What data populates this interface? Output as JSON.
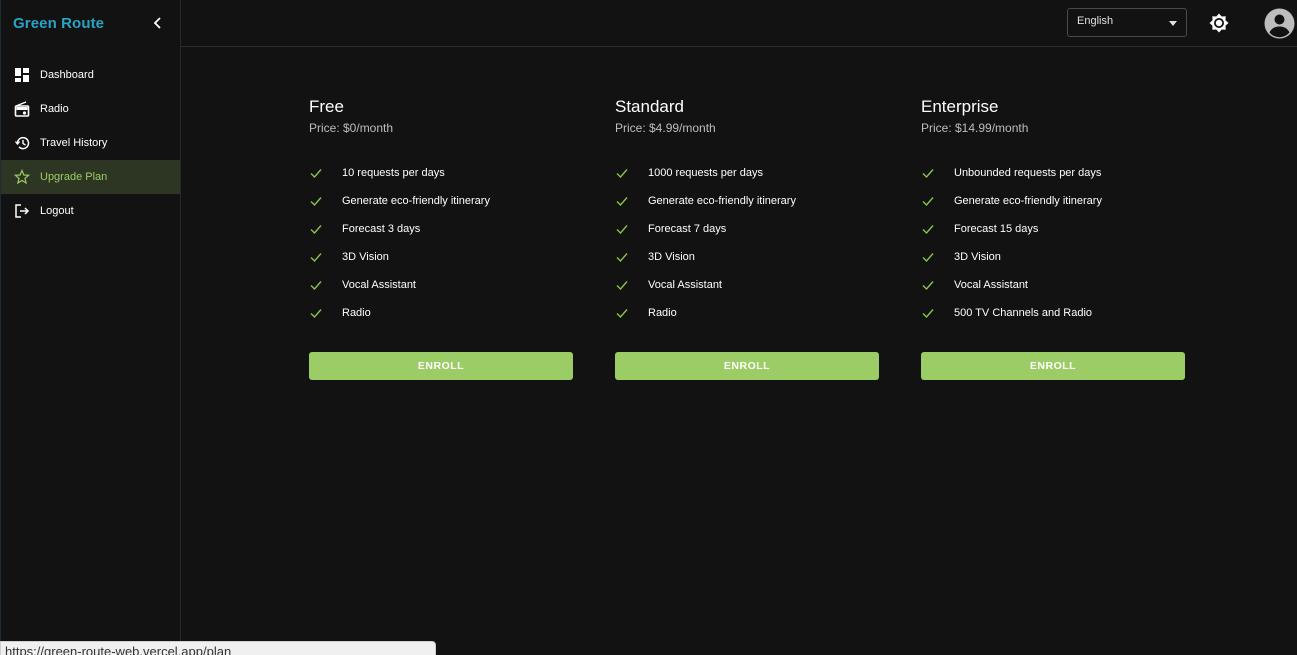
{
  "sidebar": {
    "brand": "Green Route",
    "items": [
      {
        "label": "Dashboard",
        "icon": "dashboard-icon"
      },
      {
        "label": "Radio",
        "icon": "radio-icon"
      },
      {
        "label": "Travel History",
        "icon": "history-icon"
      },
      {
        "label": "Upgrade Plan",
        "icon": "star-icon",
        "active": true
      },
      {
        "label": "Logout",
        "icon": "logout-icon"
      }
    ]
  },
  "topbar": {
    "language": "English"
  },
  "plans": [
    {
      "name": "Free",
      "price": "Price: $0/month",
      "features": [
        "10 requests per days",
        "Generate eco-friendly itinerary",
        "Forecast 3 days",
        "3D Vision",
        "Vocal Assistant",
        "Radio"
      ],
      "button": "ENROLL"
    },
    {
      "name": "Standard",
      "price": "Price: $4.99/month",
      "features": [
        "1000 requests per days",
        "Generate eco-friendly itinerary",
        "Forecast 7 days",
        "3D Vision",
        "Vocal Assistant",
        "Radio"
      ],
      "button": "ENROLL"
    },
    {
      "name": "Enterprise",
      "price": "Price: $14.99/month",
      "features": [
        "Unbounded requests per days",
        "Generate eco-friendly itinerary",
        "Forecast 15 days",
        "3D Vision",
        "Vocal Assistant",
        "500 TV Channels and Radio"
      ],
      "button": "ENROLL"
    }
  ],
  "status_bar": {
    "url": "https://green-route-web.vercel.app/plan"
  },
  "colors": {
    "brand": "#29a3c4",
    "accent": "#9ccc65",
    "background": "#121212",
    "active_nav_bg": "#2d3523"
  }
}
